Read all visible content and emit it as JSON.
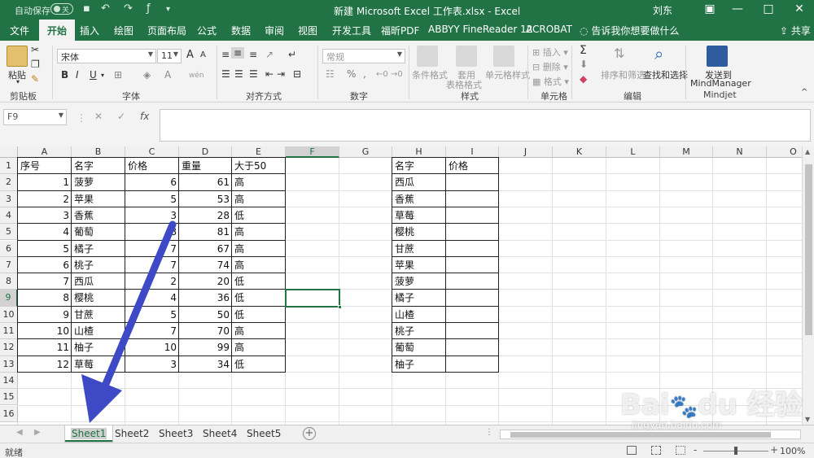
{
  "titlebar": {
    "autosave_label": "自动保存",
    "autosave_state": "关",
    "document_title": "新建 Microsoft Excel 工作表.xlsx - Excel",
    "user": "刘东",
    "minimize": "—",
    "restore": "□",
    "close": "✕",
    "ribbon_display": "▣"
  },
  "tabs": [
    "文件",
    "开始",
    "插入",
    "绘图",
    "页面布局",
    "公式",
    "数据",
    "审阅",
    "视图",
    "开发工具",
    "福昕PDF",
    "ABBYY FineReader 12",
    "ACROBAT"
  ],
  "active_tab": "开始",
  "tell_me": "告诉我你想要做什么",
  "share": "共享",
  "ribbon": {
    "clipboard": {
      "paste": "粘贴",
      "label": "剪贴板"
    },
    "font": {
      "name": "宋体",
      "size": "11",
      "grow": "A",
      "shrink": "A",
      "bold": "B",
      "italic": "I",
      "underline": "U",
      "label": "字体",
      "wen": "wén"
    },
    "alignment": {
      "label": "对齐方式"
    },
    "number": {
      "format": "常规",
      "label": "数字",
      "percent": "%",
      "comma": ","
    },
    "styles": {
      "conditional": "条件格式",
      "table": "套用\n表格格式",
      "cell": "单元格样式",
      "label": "样式"
    },
    "cells": {
      "insert": "插入",
      "delete": "删除",
      "format": "格式",
      "label": "单元格"
    },
    "editing": {
      "sort": "排序和筛选",
      "find": "查找和选择",
      "label": "编辑",
      "sum": "Σ"
    },
    "mindjet": {
      "send": "发送到",
      "target": "MindManager",
      "label": "Mindjet"
    }
  },
  "formula_bar": {
    "name_box": "F9",
    "cancel": "✕",
    "enter": "✓",
    "fx": "fx",
    "content": ""
  },
  "columns": [
    "A",
    "B",
    "C",
    "D",
    "E",
    "F",
    "G",
    "H",
    "I",
    "J",
    "K",
    "L",
    "M",
    "N",
    "O"
  ],
  "rows": [
    "1",
    "2",
    "3",
    "4",
    "5",
    "6",
    "7",
    "8",
    "9",
    "10",
    "11",
    "12",
    "13",
    "14",
    "15",
    "16"
  ],
  "table1": {
    "headers": [
      "序号",
      "名字",
      "价格",
      "重量",
      "大于50"
    ],
    "rows": [
      [
        "1",
        "菠萝",
        "6",
        "61",
        "高"
      ],
      [
        "2",
        "苹果",
        "5",
        "53",
        "高"
      ],
      [
        "3",
        "香蕉",
        "3",
        "28",
        "低"
      ],
      [
        "4",
        "葡萄",
        "8",
        "81",
        "高"
      ],
      [
        "5",
        "橘子",
        "7",
        "67",
        "高"
      ],
      [
        "6",
        "桃子",
        "7",
        "74",
        "高"
      ],
      [
        "7",
        "西瓜",
        "2",
        "20",
        "低"
      ],
      [
        "8",
        "樱桃",
        "4",
        "36",
        "低"
      ],
      [
        "9",
        "甘蔗",
        "5",
        "50",
        "低"
      ],
      [
        "10",
        "山楂",
        "7",
        "70",
        "高"
      ],
      [
        "11",
        "柚子",
        "10",
        "99",
        "高"
      ],
      [
        "12",
        "草莓",
        "3",
        "34",
        "低"
      ]
    ]
  },
  "table2": {
    "headers": [
      "名字",
      "价格"
    ],
    "names": [
      "西瓜",
      "香蕉",
      "草莓",
      "樱桃",
      "甘蔗",
      "苹果",
      "菠萝",
      "橘子",
      "山楂",
      "桃子",
      "葡萄",
      "柚子"
    ]
  },
  "selected_cell": "F9",
  "sheets": [
    "Sheet1",
    "Sheet2",
    "Sheet3",
    "Sheet4",
    "Sheet5"
  ],
  "active_sheet": "Sheet1",
  "status": {
    "ready": "就绪",
    "zoom": "100%",
    "zoom_minus": "-",
    "zoom_plus": "+"
  },
  "watermark": {
    "brand": "Bai du 经验",
    "url": "jingyan.baidu.com"
  },
  "colors": {
    "excel_green": "#217346",
    "arrow": "#3e49c6"
  }
}
